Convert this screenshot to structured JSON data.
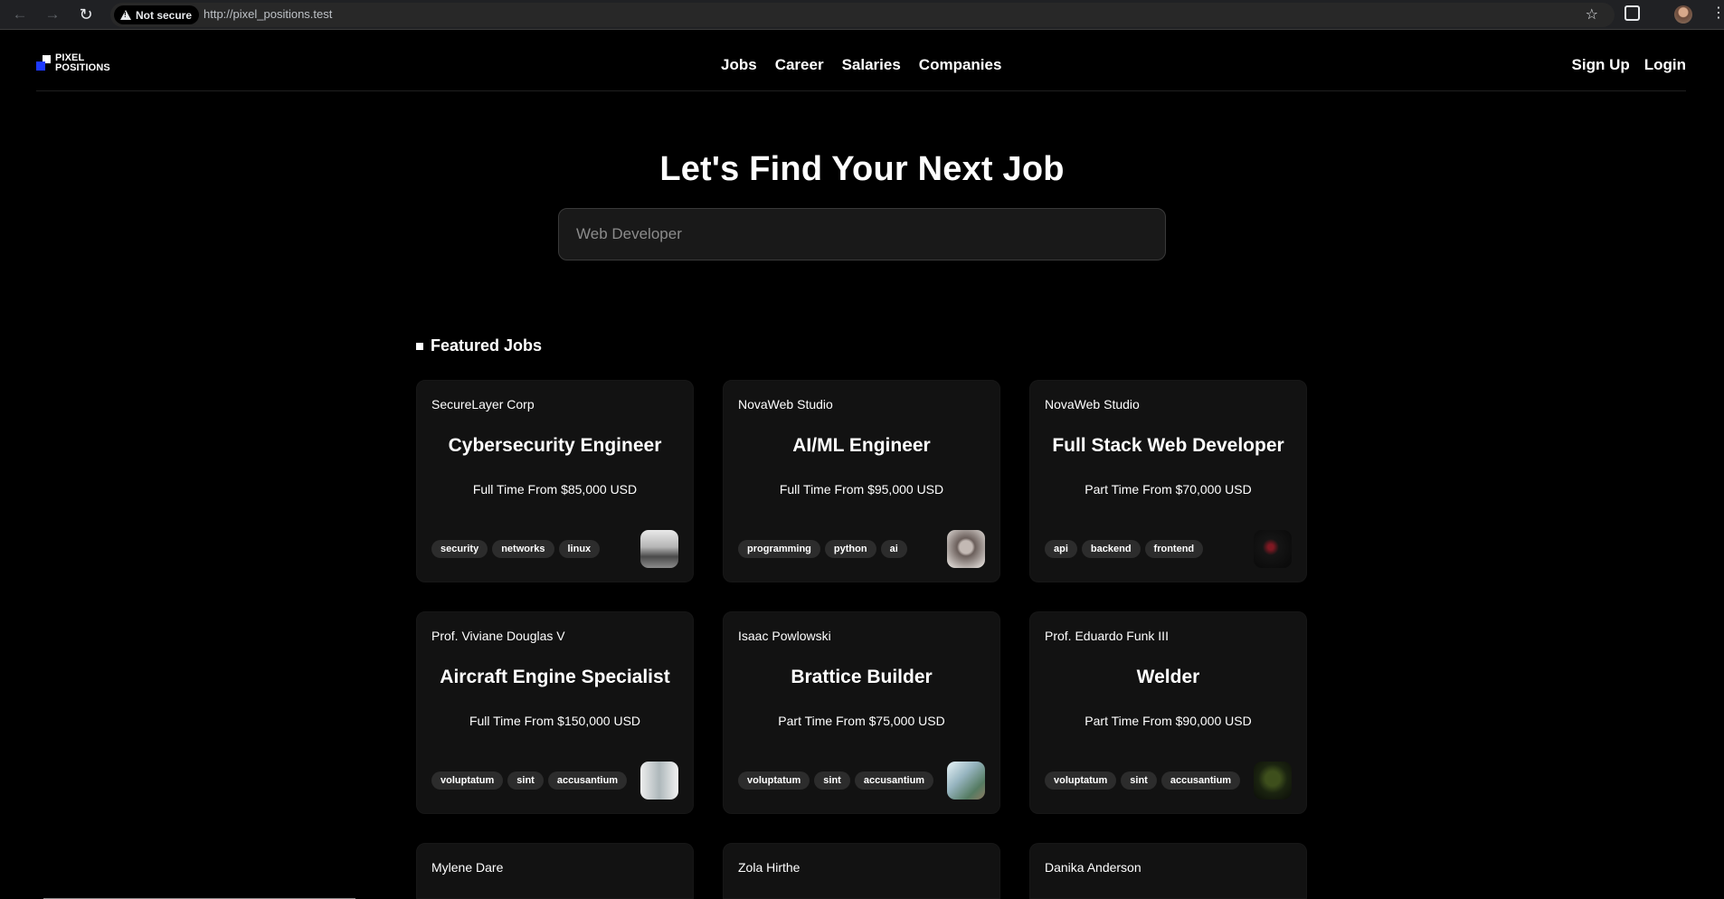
{
  "browser": {
    "security_label": "Not secure",
    "url": "http://pixel_positions.test"
  },
  "site": {
    "logo_line1": "PIXEL",
    "logo_line2": "POSITIONS",
    "nav": [
      "Jobs",
      "Career",
      "Salaries",
      "Companies"
    ],
    "auth": [
      "Sign Up",
      "Login"
    ],
    "accent_color": "#1d39ff"
  },
  "hero": {
    "title": "Let's Find Your Next Job",
    "search_placeholder": "Web Developer"
  },
  "featured": {
    "heading": "Featured Jobs",
    "jobs": [
      {
        "company": "SecureLayer Corp",
        "title": "Cybersecurity Engineer",
        "salary": "Full Time From $85,000 USD",
        "tags": [
          "security",
          "networks",
          "linux"
        ]
      },
      {
        "company": "NovaWeb Studio",
        "title": "AI/ML Engineer",
        "salary": "Full Time From $95,000 USD",
        "tags": [
          "programming",
          "python",
          "ai"
        ]
      },
      {
        "company": "NovaWeb Studio",
        "title": "Full Stack Web Developer",
        "salary": "Part Time From $70,000 USD",
        "tags": [
          "api",
          "backend",
          "frontend"
        ]
      },
      {
        "company": "Prof. Viviane Douglas V",
        "title": "Aircraft Engine Specialist",
        "salary": "Full Time From $150,000 USD",
        "tags": [
          "voluptatum",
          "sint",
          "accusantium"
        ]
      },
      {
        "company": "Isaac Powlowski",
        "title": "Brattice Builder",
        "salary": "Part Time From $75,000 USD",
        "tags": [
          "voluptatum",
          "sint",
          "accusantium"
        ]
      },
      {
        "company": "Prof. Eduardo Funk III",
        "title": "Welder",
        "salary": "Part Time From $90,000 USD",
        "tags": [
          "voluptatum",
          "sint",
          "accusantium"
        ]
      },
      {
        "company": "Mylene Dare"
      },
      {
        "company": "Zola Hirthe"
      },
      {
        "company": "Danika Anderson"
      }
    ]
  }
}
